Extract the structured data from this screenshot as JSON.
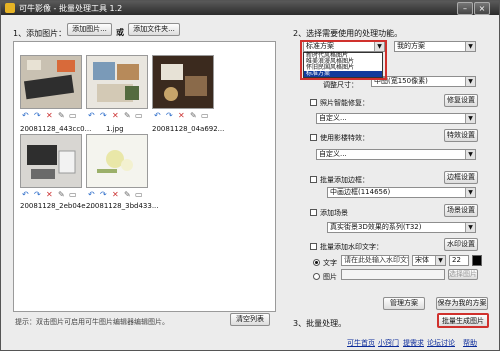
{
  "app": {
    "title": "可牛影像 - 批量处理工具 1.2"
  },
  "left": {
    "section_title": "1、添加图片：",
    "add_image_label": "添加图片...",
    "or_label": "或",
    "add_folder_label": "添加文件夹...",
    "images": [
      {
        "name": "20081128_443cc0..."
      },
      {
        "name": "1.jpg"
      },
      {
        "name": "20081128_04a692..."
      },
      {
        "name": "20081128_2eb04e..."
      },
      {
        "name": "20081128_3bd433..."
      }
    ],
    "hint": "提示：双击图片可启用可牛图片编辑器编辑图片。",
    "clear_label": "清空列表"
  },
  "right": {
    "section_title": "2、选择需要使用的处理功能。",
    "scheme_select": "标准方案",
    "my_scheme_select": "我的方案",
    "scheme_options": [
      "新时代风格图片",
      "唯美浪漫风格图片",
      "怀旧民国风格图片",
      "标准方案"
    ],
    "size_label": "调整尺寸：",
    "size_select": "中图(宽150像素)",
    "smart_fix_label": "照片智能修复：",
    "smart_fix_btn": "修复设置",
    "smart_fix_select": "自定义...",
    "effects_label": "使用影楼特效：",
    "effects_btn": "特效设置",
    "effects_select": "自定义...",
    "frame_label": "批量添加边框：",
    "frame_btn": "边框设置",
    "frame_select": "中画边框(114656)",
    "scene_label": "添加场景",
    "scene_btn": "场景设置",
    "scene_select": "真实街景3D效果的系列(T32)",
    "watermark_label": "批量添加水印文字：",
    "watermark_btn": "水印设置",
    "text_radio": "文字",
    "text_input_placeholder": "请在此处输入水印文字",
    "font_select": "宋体",
    "font_size": "22",
    "image_radio": "图片",
    "choose_image_btn": "选择图片",
    "manage_btn": "管理方案",
    "save_btn": "保存为我的方案"
  },
  "step3": {
    "title": "3、批量处理。",
    "generate_btn": "批量生成图片"
  },
  "footer": {
    "links": [
      "可牛首页",
      "小窍门",
      "提需求",
      "论坛讨论",
      "帮助"
    ]
  }
}
